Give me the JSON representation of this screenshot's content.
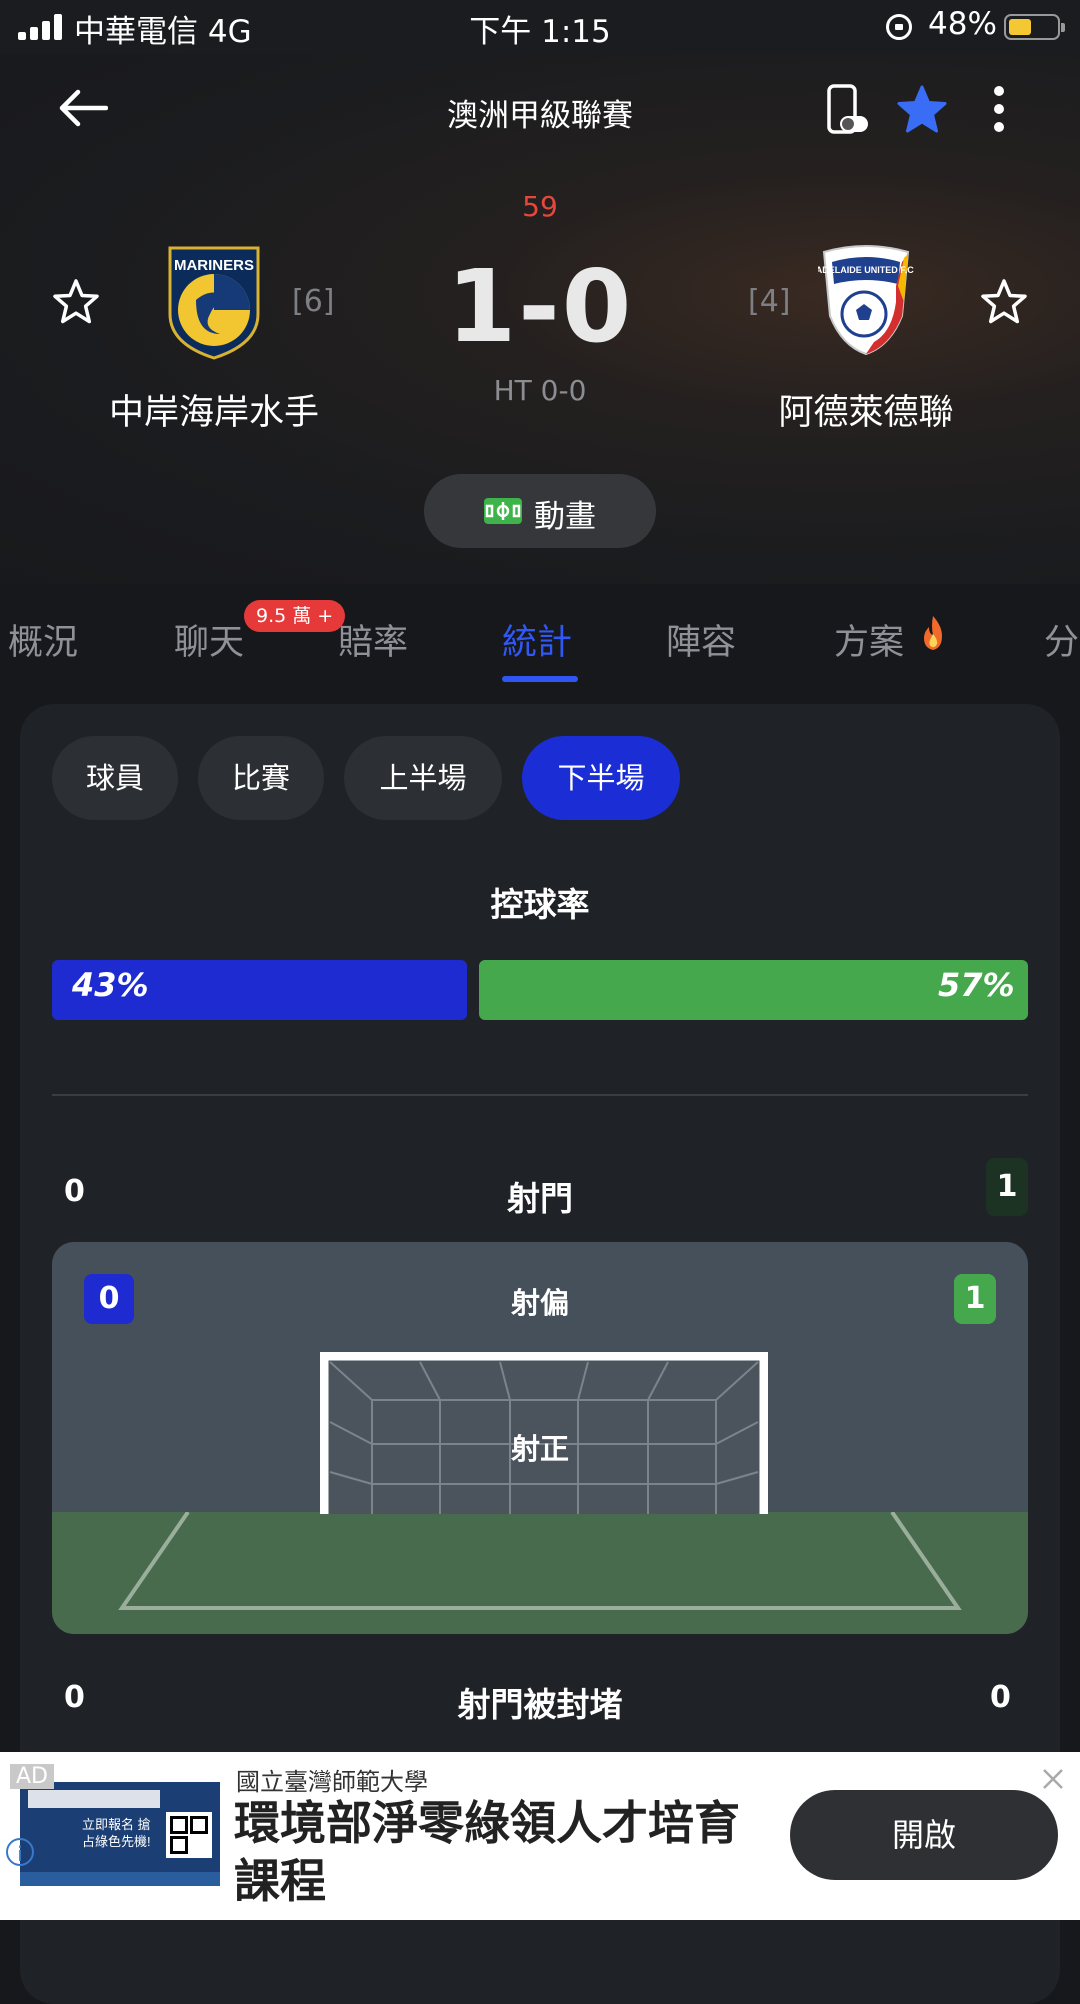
{
  "status_bar": {
    "carrier": "中華電信   4G",
    "time": "下午 1:15",
    "battery": "48%",
    "battery_level": 0.48
  },
  "header": {
    "league": "澳洲甲級聯賽",
    "minute": "59",
    "score": "1-0",
    "halftime": "HT 0-0",
    "home": {
      "name": "中岸海岸水手",
      "rank": "[6]",
      "crest_text": "MARINERS"
    },
    "away": {
      "name": "阿德萊德聯",
      "rank": "[4]",
      "crest_text": "ADELAIDE UNITED F.C."
    },
    "animation_label": "動畫"
  },
  "tabs": [
    {
      "label": "概況"
    },
    {
      "label": "聊天",
      "badge": "9.5 萬 +"
    },
    {
      "label": "賠率"
    },
    {
      "label": "統計",
      "active": true
    },
    {
      "label": "陣容"
    },
    {
      "label": "方案"
    },
    {
      "label": "分"
    }
  ],
  "period_pills": [
    {
      "label": "球員"
    },
    {
      "label": "比賽"
    },
    {
      "label": "上半場"
    },
    {
      "label": "下半場",
      "active": true
    }
  ],
  "stats": {
    "possession": {
      "title": "控球率",
      "home": "43%",
      "away": "57%",
      "home_fraction": 0.43
    },
    "shots": {
      "title": "射門",
      "home": "0",
      "away": "1"
    },
    "shots_off_target": {
      "title": "射偏",
      "home": "0",
      "away": "1"
    },
    "shots_on_target": {
      "title": "射正"
    },
    "shots_blocked": {
      "title": "射門被封堵",
      "home": "0",
      "away": "0"
    }
  },
  "colors": {
    "home": "#1d2bd1",
    "away": "#45a84d",
    "accent": "#2f55f2",
    "minute": "#e5473b"
  },
  "ad": {
    "tag": "AD",
    "sponsor": "國立臺灣師範大學",
    "headline": "環境部淨零綠領人才培育課程",
    "cta": "開啟",
    "image_text": "立即報名 搶占綠色先機!"
  }
}
